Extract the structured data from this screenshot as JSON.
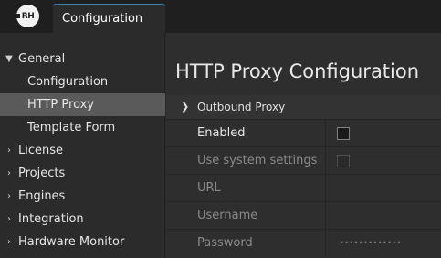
{
  "app": {
    "logo_text": "RH",
    "active_tab": "Configuration"
  },
  "sidebar": {
    "items": [
      {
        "label": "General",
        "expanded": true
      },
      {
        "label": "Configuration",
        "child": true
      },
      {
        "label": "HTTP Proxy",
        "child": true,
        "selected": true
      },
      {
        "label": "Template Form",
        "child": true
      },
      {
        "label": "License",
        "expanded": false
      },
      {
        "label": "Projects",
        "expanded": false
      },
      {
        "label": "Engines",
        "expanded": false
      },
      {
        "label": "Integration",
        "expanded": false
      },
      {
        "label": "Hardware Monitor",
        "expanded": false
      }
    ]
  },
  "main": {
    "title": "HTTP Proxy Configuration",
    "section": {
      "label": "Outbound Proxy",
      "expanded": true
    },
    "fields": [
      {
        "label": "Enabled",
        "type": "checkbox",
        "checked": false,
        "disabled": false
      },
      {
        "label": "Use system settings",
        "type": "checkbox",
        "checked": false,
        "disabled": true
      },
      {
        "label": "URL",
        "type": "text",
        "value": "",
        "disabled": true
      },
      {
        "label": "Username",
        "type": "text",
        "value": "",
        "disabled": true
      },
      {
        "label": "Password",
        "type": "password",
        "value": "•••••••••••••",
        "disabled": true
      }
    ]
  },
  "colors": {
    "accent": "#3c7fb1",
    "selected_bg": "#5a5a5a",
    "background": "#2b2b2b"
  }
}
